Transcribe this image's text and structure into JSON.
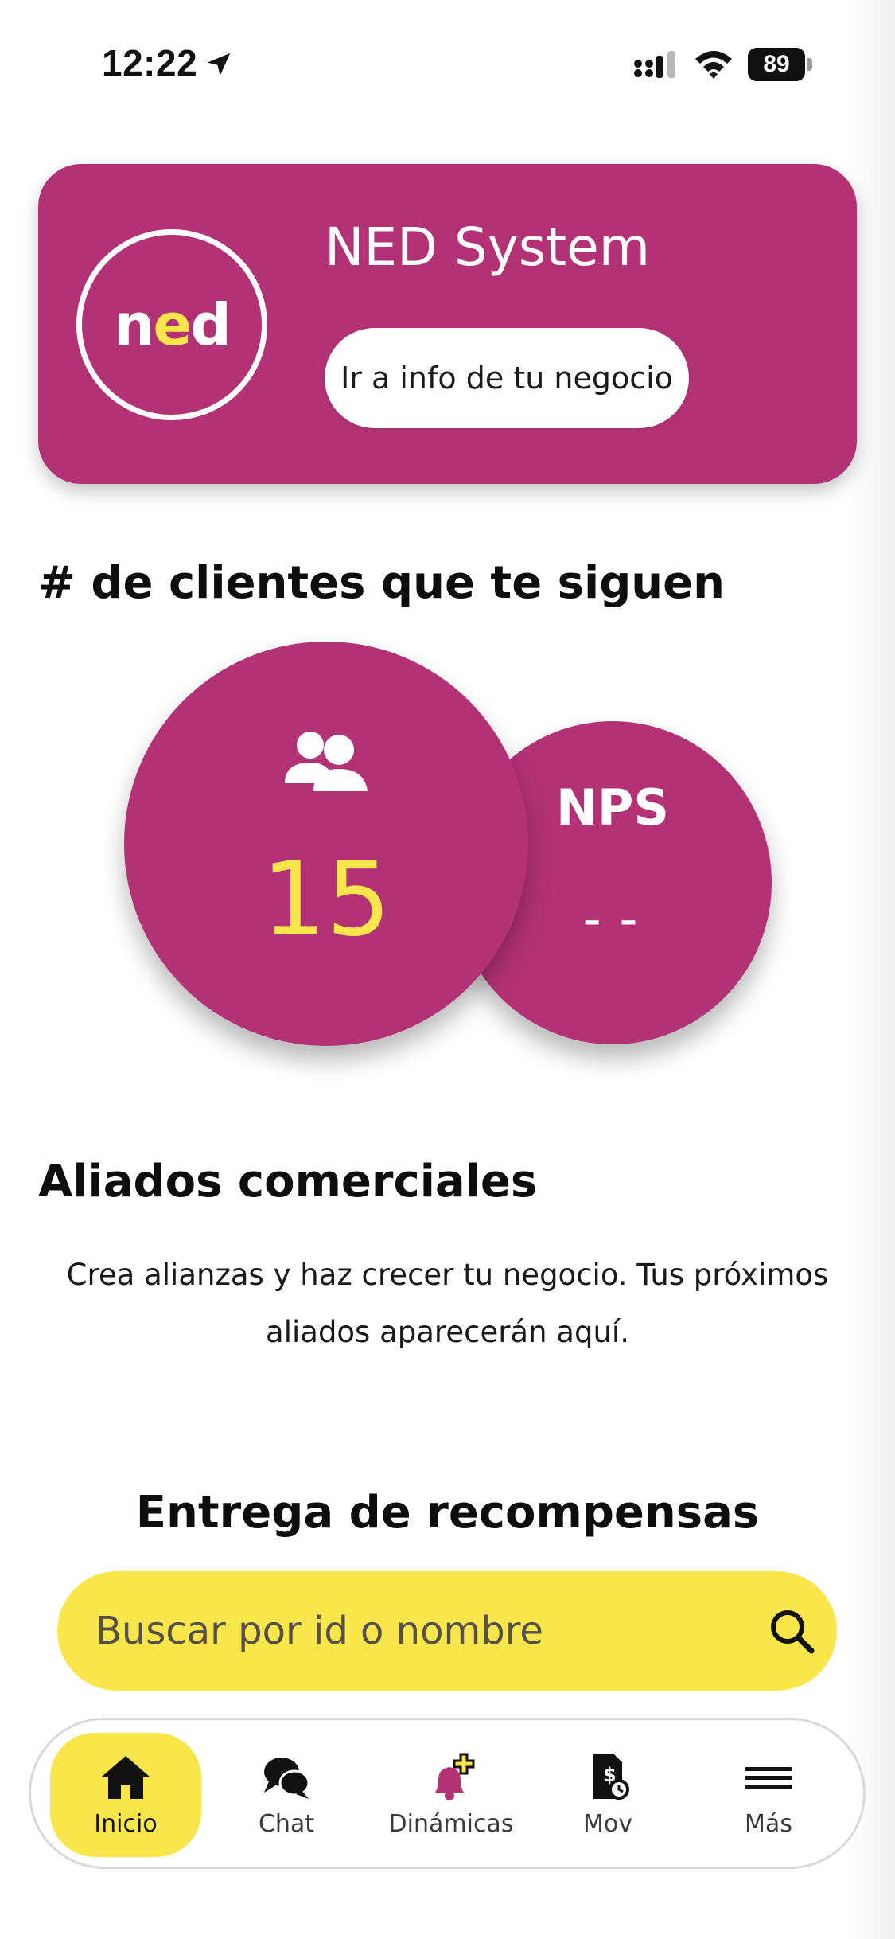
{
  "status_bar": {
    "time": "12:22",
    "battery": "89",
    "icons": [
      "location-arrow-icon",
      "signal-icon",
      "wifi-icon",
      "battery-icon"
    ]
  },
  "business": {
    "logo_text_left": "n",
    "logo_text_mid": "e",
    "logo_text_right": "d",
    "name": "NED System",
    "info_button": "Ir a info de tu negocio"
  },
  "followers": {
    "title": "# de clientes que te siguen",
    "count": "15",
    "nps_label": "NPS",
    "nps_value": "--"
  },
  "allies": {
    "title": "Aliados comerciales",
    "description": "Crea alianzas y haz crecer tu negocio. Tus próximos aliados aparecerán aquí."
  },
  "rewards": {
    "title": "Entrega de recompensas",
    "search_placeholder": "Buscar por id o nombre"
  },
  "tabbar": {
    "items": [
      {
        "label": "Inicio",
        "icon": "home-icon",
        "active": true
      },
      {
        "label": "Chat",
        "icon": "chat-bubbles-icon",
        "active": false
      },
      {
        "label": "Dinámicas",
        "icon": "bell-plus-icon",
        "active": false
      },
      {
        "label": "Mov",
        "icon": "document-dollar-icon",
        "active": false
      },
      {
        "label": "Más",
        "icon": "menu-icon",
        "active": false
      }
    ]
  },
  "colors": {
    "brand_magenta": "#b33276",
    "brand_yellow": "#f9e64a",
    "text_dark": "#0d0d0d"
  }
}
